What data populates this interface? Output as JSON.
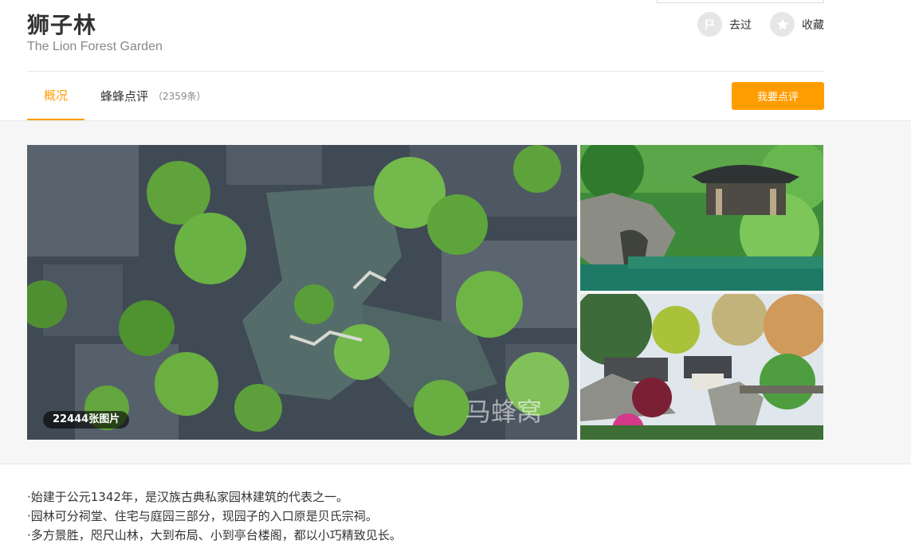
{
  "header": {
    "title": "狮子林",
    "subtitle": "The Lion Forest Garden"
  },
  "actions": {
    "been_label": "去过",
    "favorite_label": "收藏"
  },
  "tabs": {
    "overview_label": "概况",
    "reviews_label": "蜂蜂点评",
    "reviews_count": "（2359条）"
  },
  "review_button_label": "我要点评",
  "gallery": {
    "photo_count_label": "22444张图片",
    "watermark": "马蜂窝"
  },
  "description": [
    "·始建于公元1342年，是汉族古典私家园林建筑的代表之一。",
    "·园林可分祠堂、住宅与庭园三部分，现园子的入口原是贝氏宗祠。",
    "·多方景胜，咫尺山林，大到布局、小到亭台楼阁，都以小巧精致见长。"
  ],
  "colors": {
    "accent": "#ff9d00",
    "title_text": "#333333",
    "subtitle_text": "#888888"
  }
}
